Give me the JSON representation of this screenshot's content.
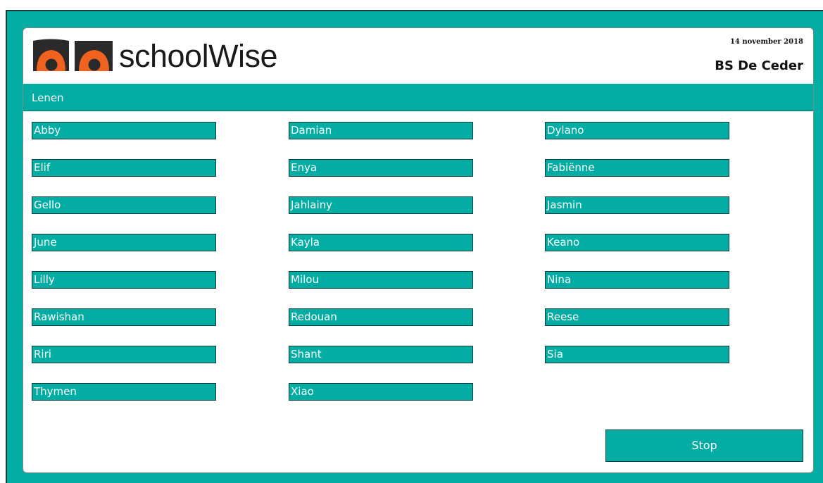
{
  "header": {
    "brand": "schoolWise",
    "date": "14 november 2018",
    "school": "BS De Ceder"
  },
  "titlebar": {
    "title": "Lenen"
  },
  "students": {
    "col1": [
      "Abby",
      "Elif",
      "Gello",
      "June",
      "Lilly",
      "Rawishan",
      "Riri",
      "Thymen"
    ],
    "col2": [
      "Damian",
      "Enya",
      "Jahlainy",
      "Kayla",
      "Milou",
      "Redouan",
      "Shant",
      "Xiao"
    ],
    "col3": [
      "Dylano",
      "Fabiënne",
      "Jasmin",
      "Keano",
      "Nina",
      "Reese",
      "Sia"
    ]
  },
  "actions": {
    "stop_label": "Stop"
  },
  "colors": {
    "accent": "#04ada4",
    "logo_orange": "#f0621f",
    "logo_dark": "#2a2a2a"
  },
  "icons": {
    "logo": "owl-eyes-logo"
  }
}
